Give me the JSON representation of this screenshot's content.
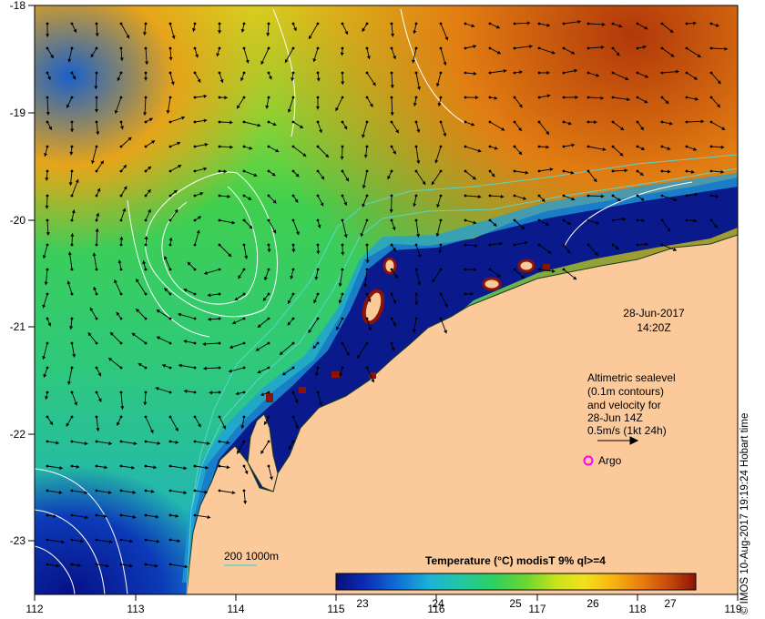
{
  "map": {
    "date_label": "28-Jun-2017",
    "time_label": "14:20Z",
    "info_lines": [
      "Altimetric sealevel",
      "(0.1m contours)",
      "and velocity for",
      "28-Jun 14Z",
      "0.5m/s (1kt 24h)"
    ],
    "argo_label": "Argo",
    "depth_legend": "200  1000m",
    "colorbar_title": "Temperature (°C) modisT 9% ql>=4",
    "colorbar_ticks": [
      "23",
      "24",
      "25",
      "26",
      "27"
    ],
    "x_ticks": [
      "112",
      "113",
      "114",
      "115",
      "116",
      "117",
      "118",
      "119"
    ],
    "y_ticks": [
      "-18",
      "-19",
      "-20",
      "-21",
      "-22",
      "-23"
    ],
    "credit": "© IMOS 10-Aug-2017 19:19:24 Hobart time",
    "colors": {
      "land": "#fbc99a",
      "cold": "#0a1a8c",
      "warm": "#e07a10",
      "contour": "#ffffff",
      "argo": "#ff00ff",
      "shelf": "#5fd3c8"
    },
    "colorscale": [
      "#08107a",
      "#0a2db4",
      "#0f6fd6",
      "#1cb2d8",
      "#21c8a0",
      "#2ed060",
      "#6cd631",
      "#c6e21d",
      "#f2e11a",
      "#f7b314",
      "#e87c0f",
      "#c4470c",
      "#8a1407"
    ]
  }
}
